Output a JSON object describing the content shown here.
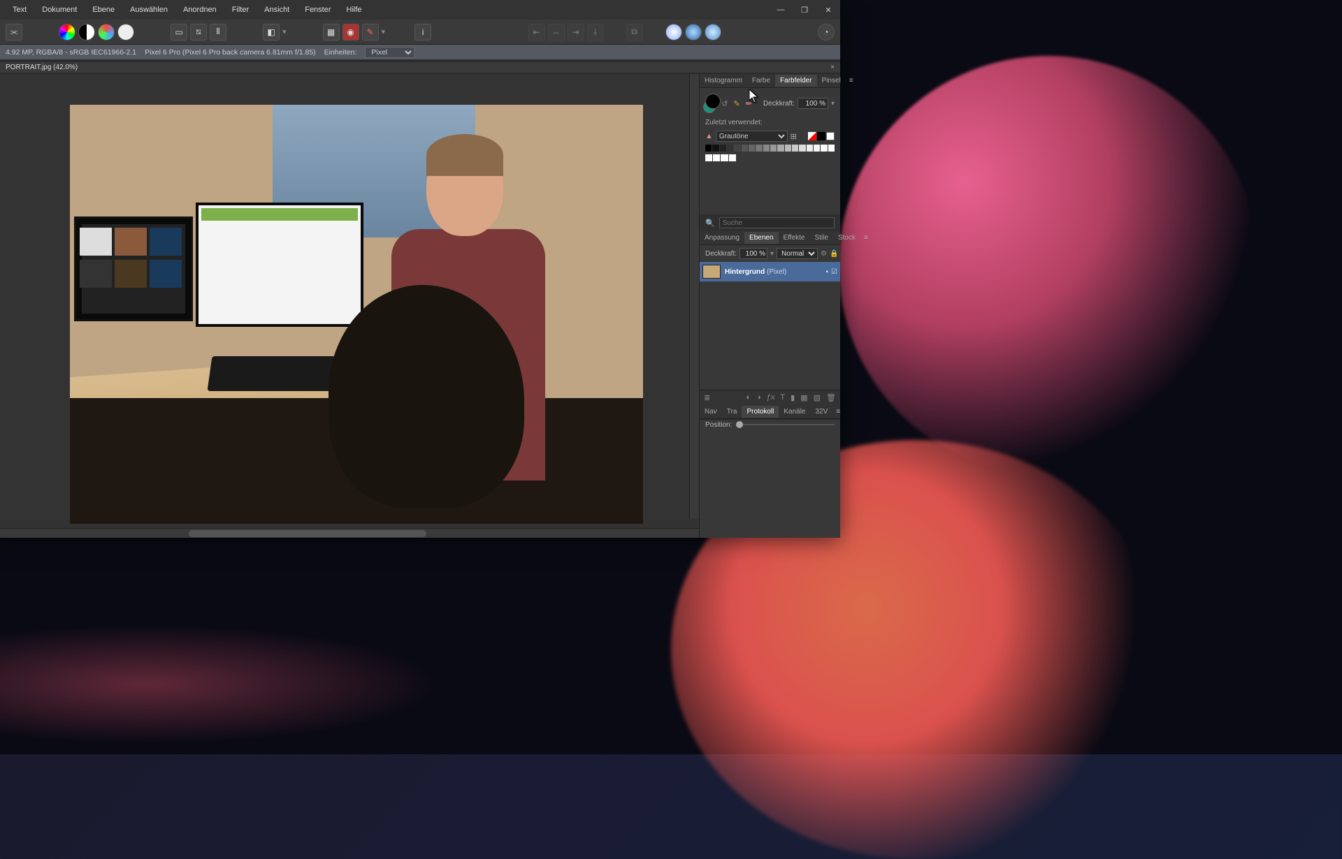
{
  "window": {
    "minimize": "—",
    "maximize": "❐",
    "close": "✕"
  },
  "menu": {
    "text": "Text",
    "dokument": "Dokument",
    "ebene": "Ebene",
    "auswaehlen": "Auswählen",
    "anordnen": "Anordnen",
    "filter": "Filter",
    "ansicht": "Ansicht",
    "fenster": "Fenster",
    "hilfe": "Hilfe"
  },
  "contextbar": {
    "info": "4.92 MP, RGBA/8 - sRGB IEC61966-2.1",
    "camera": "Pixel 6 Pro (Pixel 6 Pro back camera 6.81mm f/1.85)",
    "units_label": "Einheiten:",
    "units_value": "Pixel"
  },
  "doc_tab": {
    "title": "PORTRAIT.jpg (42.0%)",
    "close": "×"
  },
  "panels": {
    "top_tabs": {
      "histogramm": "Histogramm",
      "farbe": "Farbe",
      "farbfelder": "Farbfelder",
      "pinsel": "Pinsel"
    },
    "deckkraft_label": "Deckkraft:",
    "deckkraft_value": "100 %",
    "zuletzt": "Zuletzt verwendet:",
    "palette_name": "Grautöne",
    "search_placeholder": "Suche",
    "mid_tabs": {
      "anpassung": "Anpassung",
      "ebenen": "Ebenen",
      "effekte": "Effekte",
      "stile": "Stile",
      "stock": "Stock"
    },
    "layers": {
      "deckkraft_label": "Deckkraft:",
      "deckkraft_value": "100 %",
      "blend_value": "Normal",
      "layer_name": "Hintergrund",
      "layer_type": "(Pixel)"
    },
    "bottom_tabs": {
      "nav": "Nav",
      "tra": "Tra",
      "protokoll": "Protokoll",
      "kanaele": "Kanäle",
      "s32v": "32V"
    },
    "position_label": "Position:"
  },
  "grayscale": [
    "#000000",
    "#111111",
    "#222222",
    "#333333",
    "#444444",
    "#555555",
    "#666666",
    "#777777",
    "#888888",
    "#999999",
    "#aaaaaa",
    "#bbbbbb",
    "#cccccc",
    "#dddddd",
    "#eeeeee",
    "#f5f5f5",
    "#fafafa",
    "#ffffff",
    "#ffffff",
    "#ffffff",
    "#ffffff",
    "#ffffff"
  ]
}
